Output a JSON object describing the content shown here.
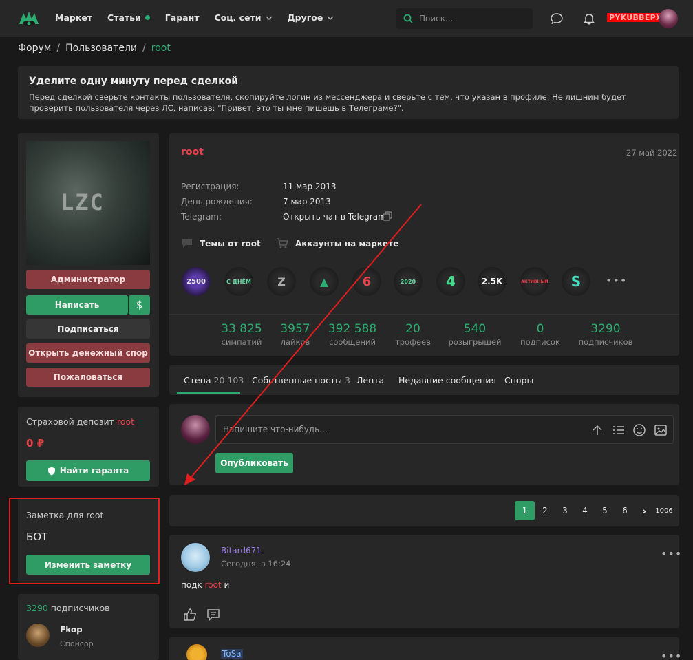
{
  "topbar": {
    "nav": [
      {
        "label": "Маркет"
      },
      {
        "label": "Статьи"
      },
      {
        "label": "Гарант"
      },
      {
        "label": "Соц. сети"
      },
      {
        "label": "Другое"
      }
    ],
    "search_placeholder": "Поиск...",
    "username": "PYKUBBEPX"
  },
  "breadcrumb": {
    "items": [
      "Форум",
      "Пользователи",
      "root"
    ],
    "separator": "/"
  },
  "notice": {
    "title": "Уделите одну минуту перед сделкой",
    "text": "Перед сделкой сверьте контакты пользователя, скопируйте логин из мессенджера и сверьте с тем, что указан в профиле. Не лишним будет проверить пользователя через ЛС, написав: \"Привет, это ты мне пишешь в Телеграме?\"."
  },
  "left": {
    "avatar_text": "LZC",
    "buttons": {
      "role": "Администратор",
      "write": "Написать",
      "money": "$",
      "subscribe": "Подписаться",
      "dispute": "Открыть денежный спор",
      "report": "Пожаловаться"
    },
    "deposit": {
      "label": "Страховой депозит",
      "user": "root",
      "amount": "0 ₽",
      "button": "Найти гаранта"
    },
    "note": {
      "label": "Заметка для root",
      "text": "БОТ",
      "button": "Изменить заметку"
    },
    "followers": {
      "count": "3290",
      "label": "подписчиков",
      "first_name": "Fkop",
      "first_role": "Спонсор"
    }
  },
  "profile": {
    "name": "root",
    "date": "27 май 2022",
    "info": [
      {
        "key": "Регистрация:",
        "value": "11 мар 2013"
      },
      {
        "key": "День рождения:",
        "value": "7 мар 2013"
      },
      {
        "key": "Telegram:",
        "value": "Открыть чат в Telegram"
      }
    ],
    "links": {
      "topics": "Темы от root",
      "accounts": "Аккаунты на маркете"
    },
    "badges": [
      "2500",
      "С ДНЁМ",
      "Z",
      "▲",
      "6",
      "2020",
      "4",
      "2.5K",
      "АКТИВНЫЙ",
      "S"
    ],
    "more": "•••",
    "stats": [
      {
        "num": "33 825",
        "label": "симпатий"
      },
      {
        "num": "3957",
        "label": "лайков"
      },
      {
        "num": "392 588",
        "label": "сообщений"
      },
      {
        "num": "20",
        "label": "трофеев"
      },
      {
        "num": "540",
        "label": "розыгрышей"
      },
      {
        "num": "0",
        "label": "подписок"
      },
      {
        "num": "3290",
        "label": "подписчиков"
      }
    ]
  },
  "tabs": [
    {
      "label": "Стена",
      "count": "20 103"
    },
    {
      "label": "Собственные посты",
      "count": "3"
    },
    {
      "label": "Лента",
      "count": ""
    },
    {
      "label": "Недавние сообщения",
      "count": ""
    },
    {
      "label": "Споры",
      "count": ""
    }
  ],
  "composer": {
    "placeholder": "Напишите что-нибудь...",
    "publish": "Опубликовать"
  },
  "pagination": [
    "1",
    "2",
    "3",
    "4",
    "5",
    "6",
    "›",
    "1006"
  ],
  "posts": [
    {
      "author": "Bitard671",
      "time": "Сегодня, в 16:24",
      "text_before": "подк",
      "mention": "root",
      "text_after": "и"
    },
    {
      "author": "ToSa",
      "time": ""
    }
  ],
  "colors": {
    "accent": "#2bad72",
    "danger": "#e8434b",
    "panel": "#272727",
    "background": "#191919"
  }
}
